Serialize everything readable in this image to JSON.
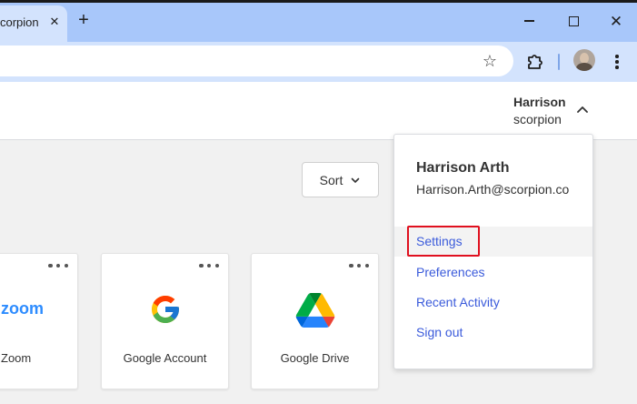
{
  "browser": {
    "tab_title": "corpion",
    "tab_close_glyph": "✕",
    "new_tab_glyph": "+",
    "window_close_glyph": "✕",
    "star_glyph": "☆"
  },
  "header": {
    "user_name": "Harrison",
    "user_org": "scorpion"
  },
  "toolbar": {
    "sort_label": "Sort"
  },
  "cards": [
    {
      "label": "Zoom",
      "logo_text": "zoom"
    },
    {
      "label": "Google Account"
    },
    {
      "label": "Google Drive"
    }
  ],
  "dropdown": {
    "name": "Harrison Arth",
    "email": "Harrison.Arth@scorpion.co",
    "items": [
      {
        "label": "Settings"
      },
      {
        "label": "Preferences"
      },
      {
        "label": "Recent Activity"
      },
      {
        "label": "Sign out"
      }
    ]
  },
  "colors": {
    "tab_strip": "#a8c7fa",
    "toolbar": "#d3e3fd",
    "link": "#3b5bdb",
    "highlight_border": "#e0101f",
    "zoom_blue": "#2d8cff"
  }
}
